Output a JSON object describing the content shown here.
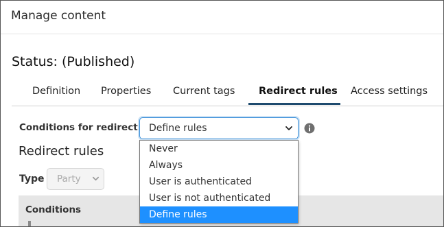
{
  "dialog": {
    "title": "Manage content"
  },
  "status": "Status: (Published)",
  "tabs": [
    {
      "label": "Definition",
      "active": false
    },
    {
      "label": "Properties",
      "active": false
    },
    {
      "label": "Current tags",
      "active": false
    },
    {
      "label": "Redirect rules",
      "active": true
    },
    {
      "label": "Access settings",
      "active": false
    }
  ],
  "redirect_condition": {
    "label": "Conditions for redirect",
    "selected": "Define rules",
    "info_icon": "info-circle-icon",
    "options": [
      "Never",
      "Always",
      "User is authenticated",
      "User is not authenticated",
      "Define rules"
    ]
  },
  "rules": {
    "heading": "Redirect rules",
    "type_label": "Type",
    "type_value": "Party",
    "conditions_label": "Conditions"
  },
  "colors": {
    "tab_underline": "#1e4b6e",
    "selected_option": "#1e90ff",
    "focus_border": "#3b8fd9"
  }
}
